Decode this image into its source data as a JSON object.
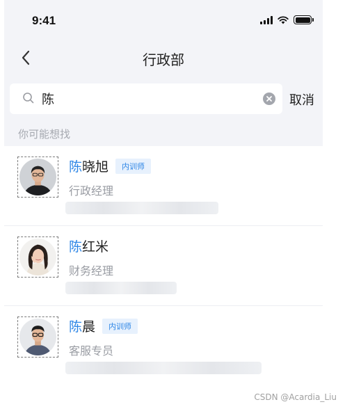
{
  "status_bar": {
    "time": "9:41"
  },
  "nav": {
    "title": "行政部",
    "back_icon": "chevron-left-icon"
  },
  "search": {
    "value": "陈",
    "cancel_label": "取消",
    "icon": "search-icon",
    "clear_icon": "clear-icon"
  },
  "section_label": "你可能想找",
  "results": [
    {
      "name_highlight": "陈",
      "name_rest": "晓旭",
      "tag": "内训师",
      "position": "行政经理"
    },
    {
      "name_highlight": "陈",
      "name_rest": "红米",
      "tag": "",
      "position": "财务经理"
    },
    {
      "name_highlight": "陈",
      "name_rest": "晨",
      "tag": "内训师",
      "position": "客服专员"
    }
  ],
  "colors": {
    "accent": "#2e86e6",
    "tag_bg": "#e7f1fd",
    "page_bg": "#f3f4f8"
  },
  "watermark": "CSDN @Acardia_Liu"
}
